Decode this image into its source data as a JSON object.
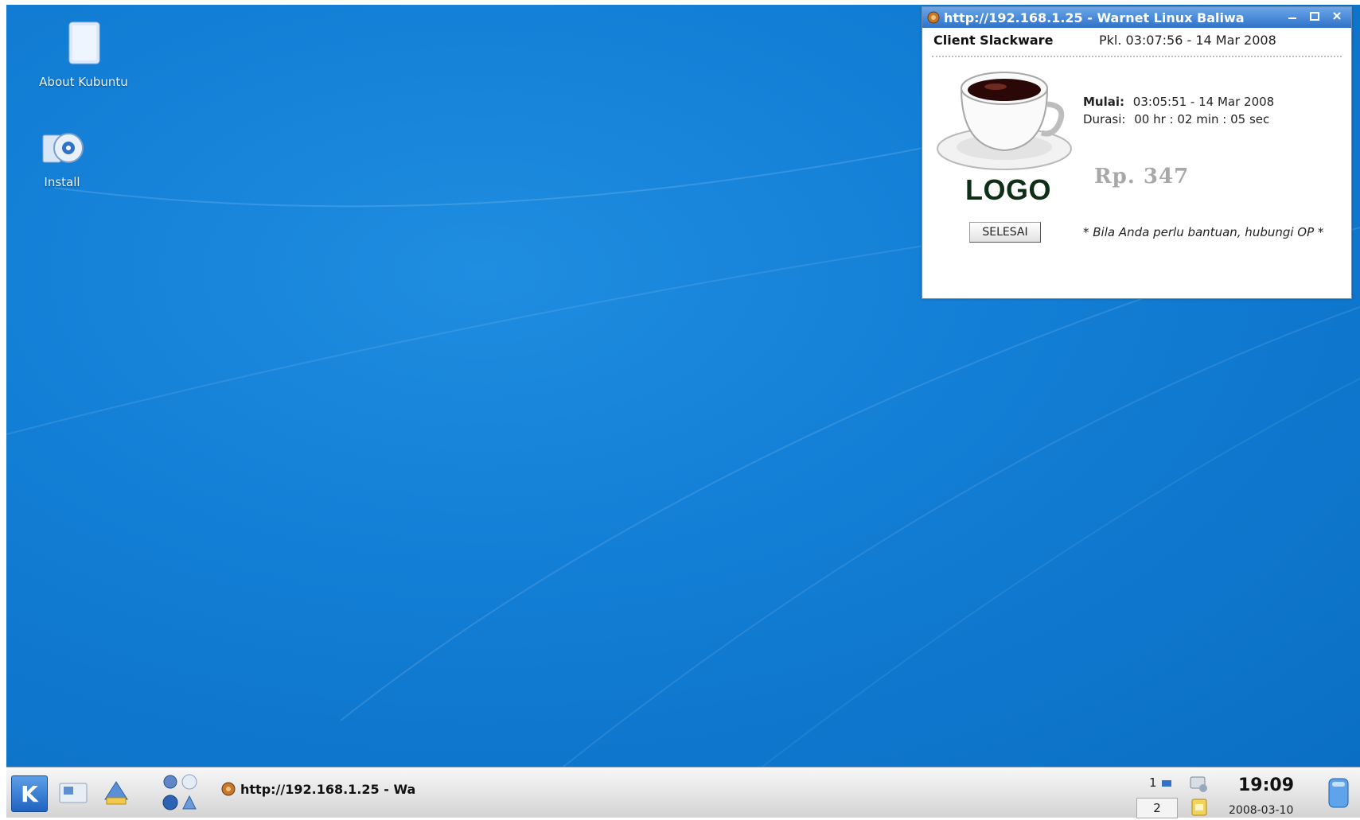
{
  "desktop": {
    "icons": [
      {
        "label": "About Kubuntu",
        "icon": "document-icon"
      },
      {
        "label": "Install",
        "icon": "install-icon"
      }
    ],
    "background_color": "#137fd6"
  },
  "billing_window": {
    "title": "http://192.168.1.25 - Warnet Linux Baliwa",
    "client_name": "Client Slackware",
    "current_time": "Pkl. 03:07:56 - 14 Mar 2008",
    "logo_text": "LOGO",
    "finish_button": "SELESAI",
    "start_label": "Mulai:",
    "start_value": "03:05:51 - 14 Mar 2008",
    "duration_label": "Durasi:",
    "duration_value": "00 hr : 02 min : 05 sec",
    "price": "Rp. 347",
    "help_text": "* Bila Anda perlu bantuan, hubungi OP *",
    "titlebar_buttons": [
      "minimize-icon",
      "maximize-icon",
      "close-icon"
    ]
  },
  "taskbar": {
    "task_title": "http://192.168.1.25 - Wa",
    "desktops": [
      "1",
      "2"
    ],
    "clock_time": "19:09",
    "clock_date": "2008-03-10"
  }
}
